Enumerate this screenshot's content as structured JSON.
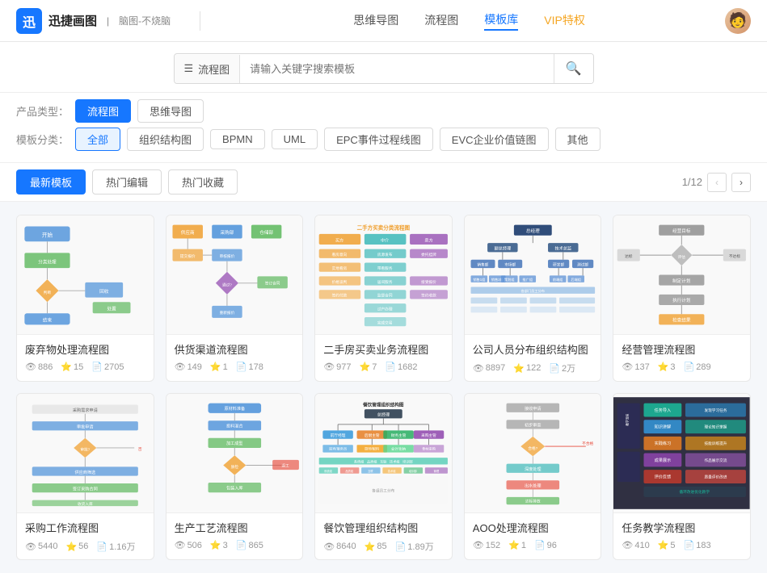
{
  "header": {
    "logo_icon": "迅",
    "logo_name": "迅捷画图",
    "logo_subtitle": "脑图-不烧脑",
    "nav_items": [
      {
        "label": "思维导图",
        "active": false
      },
      {
        "label": "流程图",
        "active": false
      },
      {
        "label": "模板库",
        "active": true
      },
      {
        "label": "VIP特权",
        "active": false,
        "vip": true
      }
    ]
  },
  "search": {
    "prefix": "流程图",
    "placeholder": "请输入关键字搜索模板"
  },
  "filters": {
    "product_label": "产品类型：",
    "product_types": [
      {
        "label": "流程图",
        "active": true
      },
      {
        "label": "思维导图",
        "active": false
      }
    ],
    "category_label": "模板分类：",
    "categories": [
      {
        "label": "全部",
        "active": true
      },
      {
        "label": "组织结构图",
        "active": false
      },
      {
        "label": "BPMN",
        "active": false
      },
      {
        "label": "UML",
        "active": false
      },
      {
        "label": "EPC事件过程线图",
        "active": false
      },
      {
        "label": "EVC企业价值链图",
        "active": false
      },
      {
        "label": "其他",
        "active": false
      }
    ]
  },
  "sort": {
    "tabs": [
      {
        "label": "最新模板",
        "active": true
      },
      {
        "label": "热门编辑",
        "active": false
      },
      {
        "label": "热门收藏",
        "active": false
      }
    ],
    "pagination": "1/12",
    "prev_disabled": true,
    "next_disabled": false
  },
  "cards": [
    {
      "title": "废弃物处理流程图",
      "views": "886",
      "likes": "15",
      "saves": "2705",
      "color": "blue"
    },
    {
      "title": "供货渠道流程图",
      "views": "149",
      "likes": "1",
      "saves": "178",
      "color": "orange"
    },
    {
      "title": "二手房买卖业务流程图",
      "views": "977",
      "likes": "7",
      "saves": "1682",
      "color": "teal-orange"
    },
    {
      "title": "公司人员分布组织结构图",
      "views": "8897",
      "likes": "122",
      "saves": "2万",
      "color": "dark-blue"
    },
    {
      "title": "经营管理流程图",
      "views": "137",
      "likes": "3",
      "saves": "289",
      "color": "gray"
    },
    {
      "title": "采购工作流程图",
      "views": "5440",
      "likes": "56",
      "saves": "1.16万",
      "color": "blue-simple"
    },
    {
      "title": "生产工艺流程图",
      "views": "506",
      "likes": "3",
      "saves": "865",
      "color": "blue-flow"
    },
    {
      "title": "餐饮管理组织结构图",
      "views": "8640",
      "likes": "85",
      "saves": "1.89万",
      "color": "multi"
    },
    {
      "title": "AOO处理流程图",
      "views": "152",
      "likes": "1",
      "saves": "96",
      "color": "orange-flow"
    },
    {
      "title": "任务教学流程图",
      "views": "410",
      "likes": "5",
      "saves": "183",
      "color": "dark-multi"
    }
  ],
  "icons": {
    "search": "🔍",
    "views": "👁",
    "likes": "⭐",
    "saves": "📄",
    "menu": "☰",
    "prev": "‹",
    "next": "›"
  }
}
